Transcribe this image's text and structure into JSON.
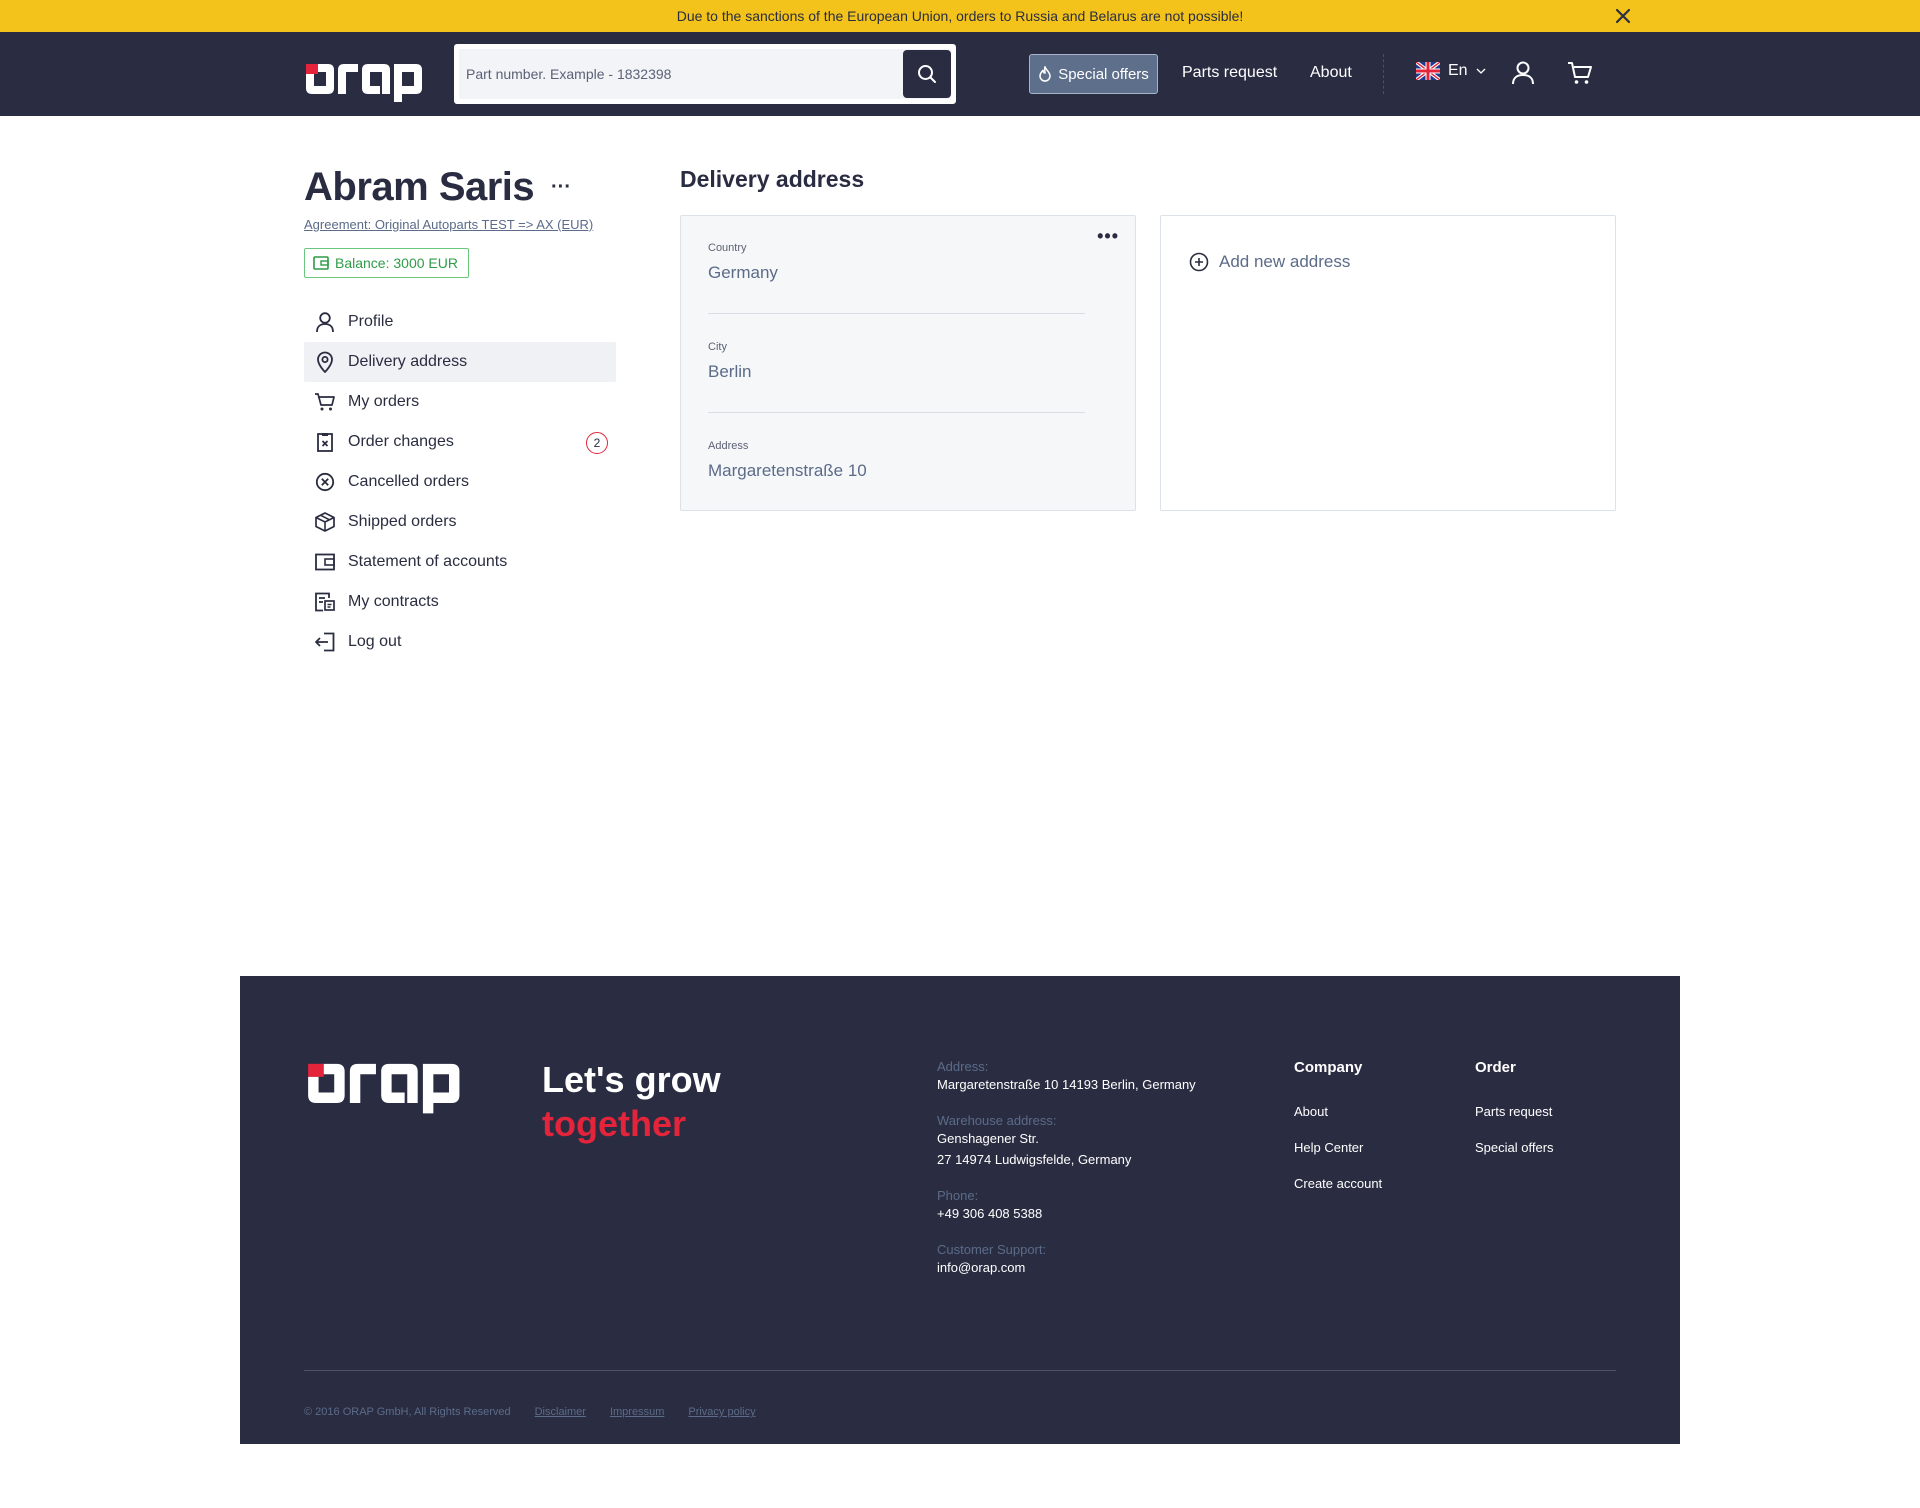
{
  "banner": {
    "text": "Due to the sanctions of the European Union, orders to Russia and Belarus are not possible!",
    "bg_color": "#f3c31c"
  },
  "header": {
    "logo_text": "orap",
    "search": {
      "placeholder": "Part number. Example - 1832398"
    },
    "nav": {
      "special_offers": "Special offers",
      "parts_request": "Parts request",
      "about": "About"
    },
    "language": "En",
    "icons": [
      "uk-flag-icon",
      "chevron-down-icon",
      "user-icon",
      "cart-icon"
    ]
  },
  "sidebar": {
    "user_name": "Abram Saris",
    "user_more": "···",
    "agreement": "Agreement: Original Autoparts TEST => AX (EUR)",
    "balance": "Balance: 3000 EUR",
    "menu": [
      {
        "label": "Profile",
        "icon": "user-icon"
      },
      {
        "label": "Delivery address",
        "icon": "location-pin-icon",
        "active": true
      },
      {
        "label": "My orders",
        "icon": "cart-icon"
      },
      {
        "label": "Order changes",
        "icon": "clipboard-x-icon",
        "badge": "2"
      },
      {
        "label": "Cancelled orders",
        "icon": "circle-x-icon"
      },
      {
        "label": "Shipped orders",
        "icon": "box-icon"
      },
      {
        "label": "Statement of accounts",
        "icon": "wallet-icon"
      },
      {
        "label": "My contracts",
        "icon": "contract-icon"
      },
      {
        "label": "Log out",
        "icon": "logout-icon"
      }
    ]
  },
  "main": {
    "title": "Delivery address",
    "address_card": {
      "more": "•••",
      "fields": [
        {
          "label": "Country",
          "value": "Germany"
        },
        {
          "label": "City",
          "value": "Berlin"
        },
        {
          "label": "Address",
          "value": "Margaretenstraße 10"
        }
      ]
    },
    "add_new": "Add new address"
  },
  "footer": {
    "logo_text": "orap",
    "tagline_1": "Let's grow",
    "tagline_2": "together",
    "info": [
      {
        "label": "Address:",
        "value": [
          "Margaretenstraße 10 14193 Berlin, Germany"
        ]
      },
      {
        "label": "Warehouse address:",
        "value": [
          "Genshagener Str.",
          "27 14974 Ludwigsfelde, Germany"
        ]
      },
      {
        "label": "Phone:",
        "value": [
          "+49 306 408 5388"
        ]
      },
      {
        "label": "Customer Support:",
        "value": [
          "info@orap.com"
        ]
      }
    ],
    "company": {
      "title": "Company",
      "links": [
        "About",
        "Help Center",
        "Create account"
      ]
    },
    "order": {
      "title": "Order",
      "links": [
        "Parts request",
        "Special offers"
      ]
    },
    "copyright": "© 2016 ORAP GmbH, All Rights Reserved",
    "legal_links": [
      "Disclaimer",
      "Impressum",
      "Privacy policy"
    ]
  },
  "colors": {
    "dark_navy": "#2a2d42",
    "accent_red": "#e3243b",
    "balance_green": "#2f9c48",
    "banner_yellow": "#f3c31c"
  }
}
